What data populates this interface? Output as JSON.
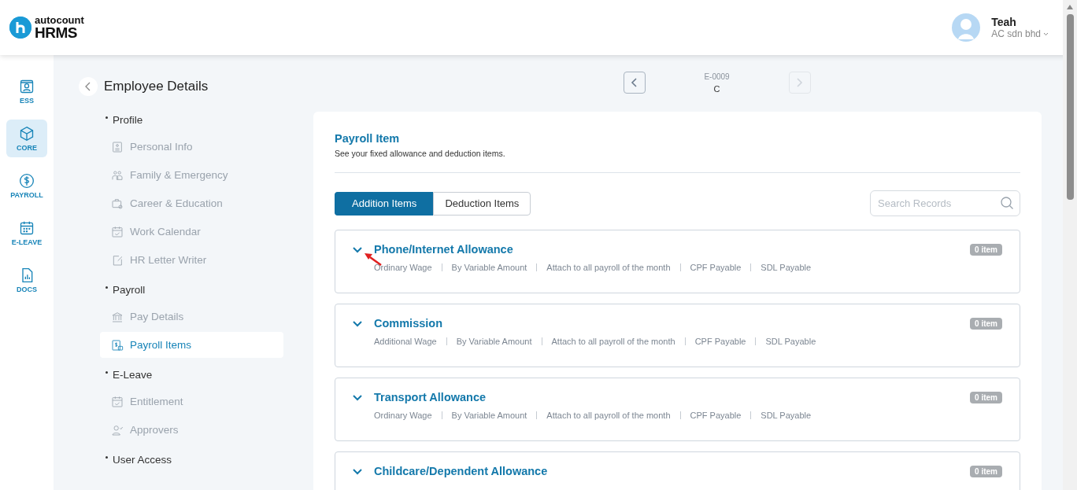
{
  "header": {
    "logo": {
      "brand": "autocount",
      "product": "HRMS"
    },
    "user": {
      "name": "Teah",
      "company": "AC sdn bhd"
    }
  },
  "rail": [
    {
      "label": "ESS",
      "selected": false,
      "kind": "person"
    },
    {
      "label": "CORE",
      "selected": true,
      "kind": "cube"
    },
    {
      "label": "PAYROLL",
      "selected": false,
      "kind": "dollar"
    },
    {
      "label": "E-LEAVE",
      "selected": false,
      "kind": "calendar"
    },
    {
      "label": "DOCS",
      "selected": false,
      "kind": "chart"
    }
  ],
  "subnav": {
    "title": "Employee Details",
    "sections": [
      {
        "label": "Profile",
        "items": [
          {
            "label": "Personal Info",
            "selected": false,
            "kind": "id"
          },
          {
            "label": "Family & Emergency",
            "selected": false,
            "kind": "family"
          },
          {
            "label": "Career & Education",
            "selected": false,
            "kind": "bag"
          },
          {
            "label": "Work Calendar",
            "selected": false,
            "kind": "calendar"
          },
          {
            "label": "HR Letter Writer",
            "selected": false,
            "kind": "letter"
          }
        ]
      },
      {
        "label": "Payroll",
        "items": [
          {
            "label": "Pay Details",
            "selected": false,
            "kind": "bank"
          },
          {
            "label": "Payroll Items",
            "selected": true,
            "kind": "payslip"
          }
        ]
      },
      {
        "label": "E-Leave",
        "items": [
          {
            "label": "Entitlement",
            "selected": false,
            "kind": "calendar"
          },
          {
            "label": "Approvers",
            "selected": false,
            "kind": "person"
          }
        ]
      },
      {
        "label": "User Access"
      }
    ]
  },
  "employee_nav": {
    "code": "E-0009",
    "name": "C",
    "prev_disabled": false,
    "next_disabled": true
  },
  "panel": {
    "title": "Payroll Item",
    "subtitle": "See your fixed allowance and deduction items.",
    "tabs": [
      {
        "label": "Addition Items",
        "selected": true
      },
      {
        "label": "Deduction Items",
        "selected": false
      }
    ],
    "search": {
      "placeholder": "Search Records"
    },
    "items": [
      {
        "name": "Phone/Internet Allowance",
        "count": "0 item",
        "expanded": false,
        "details": [
          "Ordinary Wage",
          "By Variable Amount",
          "Attach to all payroll of the month",
          "CPF Payable",
          "SDL Payable"
        ]
      },
      {
        "name": "Commission",
        "count": "0 item",
        "expanded": false,
        "details": [
          "Additional Wage",
          "By Variable Amount",
          "Attach to all payroll of the month",
          "CPF Payable",
          "SDL Payable"
        ]
      },
      {
        "name": "Transport Allowance",
        "count": "0 item",
        "expanded": false,
        "details": [
          "Ordinary Wage",
          "By Variable Amount",
          "Attach to all payroll of the month",
          "CPF Payable",
          "SDL Payable"
        ]
      },
      {
        "name": "Childcare/Dependent Allowance",
        "count": "0 item",
        "expanded": false
      }
    ]
  }
}
